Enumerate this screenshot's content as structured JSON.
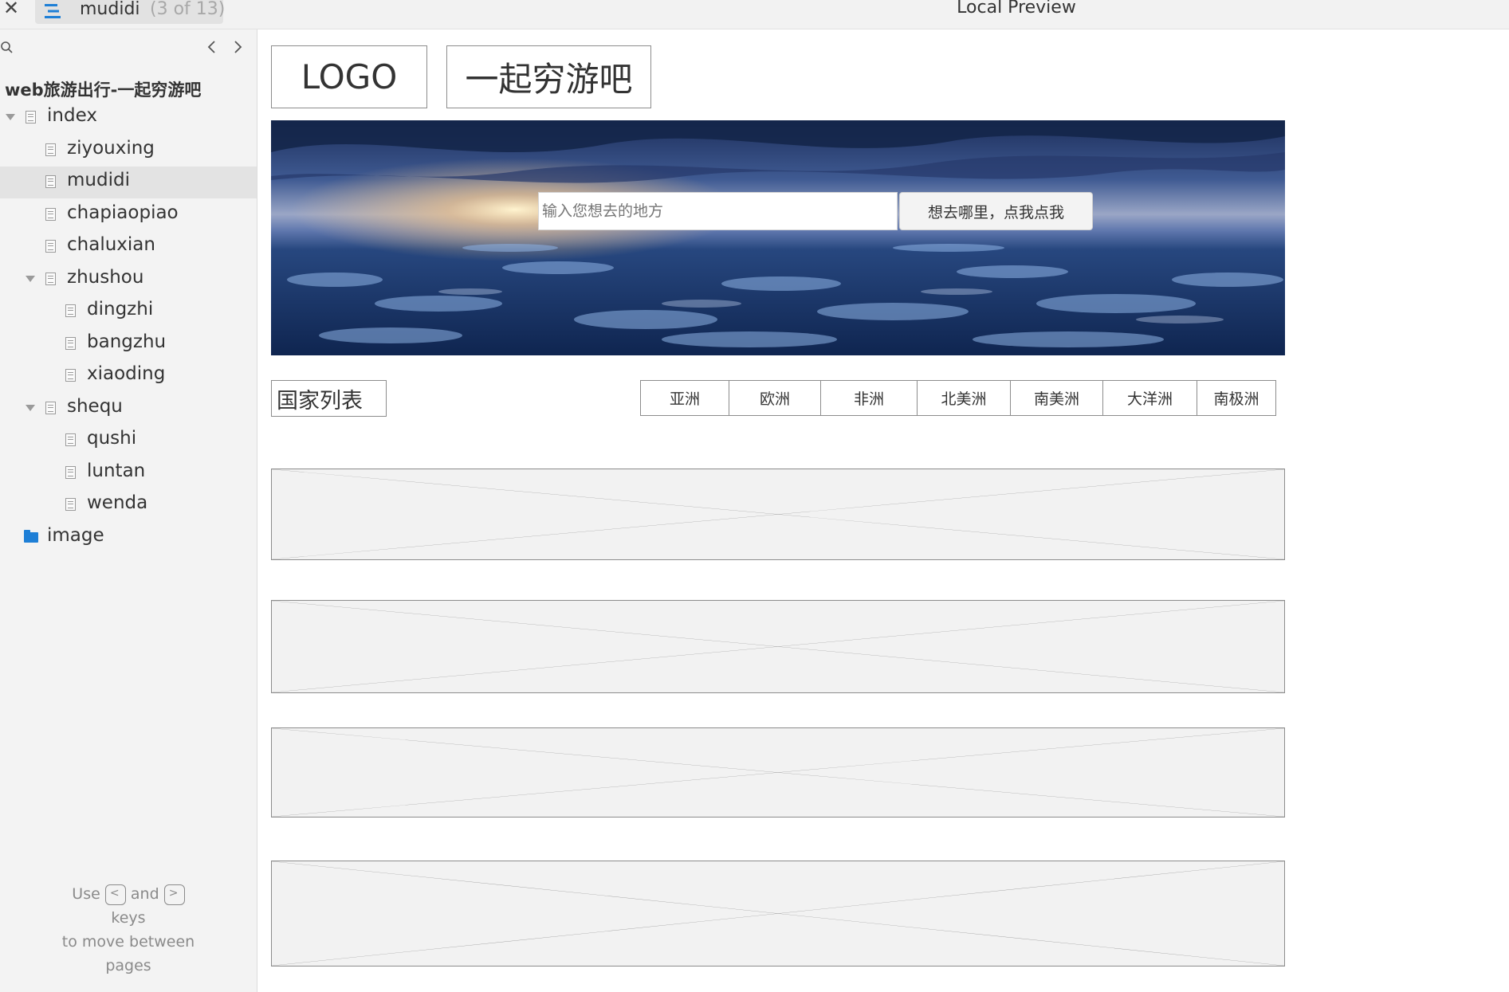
{
  "topbar": {
    "close_icon": "close-icon",
    "tab": {
      "title": "mudidi",
      "count": "(3 of 13)",
      "icon": "menu-icon"
    },
    "window_title": "Local Preview"
  },
  "sidebar": {
    "search_icon": "search-icon",
    "project_title": "web旅游出行-一起穷游吧",
    "items": [
      {
        "label": "index",
        "icon": "page-icon",
        "expanded": true,
        "level": 0
      },
      {
        "label": "ziyouxing",
        "icon": "page-icon",
        "level": 1
      },
      {
        "label": "mudidi",
        "icon": "page-icon",
        "level": 1,
        "selected": true
      },
      {
        "label": "chapiaopiao",
        "icon": "page-icon",
        "level": 1
      },
      {
        "label": "chaluxian",
        "icon": "page-icon",
        "level": 1
      },
      {
        "label": "zhushou",
        "icon": "page-icon",
        "expanded": true,
        "level": 1
      },
      {
        "label": "dingzhi",
        "icon": "page-icon",
        "level": 2
      },
      {
        "label": "bangzhu",
        "icon": "page-icon",
        "level": 2
      },
      {
        "label": "xiaoding",
        "icon": "page-icon",
        "level": 2
      },
      {
        "label": "shequ",
        "icon": "page-icon",
        "expanded": true,
        "level": 1
      },
      {
        "label": "qushi",
        "icon": "page-icon",
        "level": 2
      },
      {
        "label": "luntan",
        "icon": "page-icon",
        "level": 2
      },
      {
        "label": "wenda",
        "icon": "page-icon",
        "level": 2
      },
      {
        "label": "image",
        "icon": "folder-icon",
        "level": 0
      }
    ],
    "help": {
      "use": "Use",
      "and": "and",
      "keys": "keys",
      "line3": "to move between",
      "line4": "pages",
      "prev_key": "<",
      "next_key": ">"
    }
  },
  "preview": {
    "logo": "LOGO",
    "brand": "一起穷游吧",
    "search": {
      "placeholder": "输入您想去的地方",
      "button": "想去哪里，点我点我"
    },
    "country_list_label": "国家列表",
    "regions": [
      "亚洲",
      "欧洲",
      "非洲",
      "北美洲",
      "南美洲",
      "大洋洲",
      "南极洲"
    ],
    "placeholders": 4
  },
  "colors": {
    "folder": "#1e7fd6",
    "menu_icon": "#1e7fd6",
    "sidebar_bg": "#f3f3f3"
  }
}
